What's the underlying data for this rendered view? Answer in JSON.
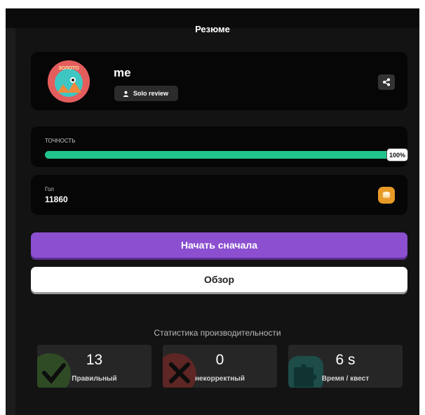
{
  "summary": {
    "title": "Резюме"
  },
  "profile": {
    "username": "me",
    "mode_badge": "Solo review",
    "avatar_text": "ЗОЛОТО",
    "icons": {
      "mode": "person-icon",
      "share": "share-icon"
    }
  },
  "accuracy": {
    "label": "ТОЧНОСТЬ",
    "percent": 100,
    "percent_label": "100%",
    "fill_color": "#22c48e"
  },
  "points": {
    "label": "Гол",
    "value": "11860",
    "icon": "coins-icon",
    "icon_color": "#e79a28"
  },
  "actions": {
    "restart_label": "Начать сначала",
    "restart_color": "#8b4fd0",
    "review_label": "Обзор"
  },
  "stats": {
    "heading": "Статистика производительности",
    "items": [
      {
        "value": "13",
        "label": "Правильный",
        "icon": "check-icon",
        "color": "#2f4b25"
      },
      {
        "value": "0",
        "label": "некорректный",
        "icon": "cross-icon",
        "color": "#5e2624"
      },
      {
        "value": "6 s",
        "label": "Время / квест",
        "icon": "puzzle-icon",
        "color": "#1d4c49"
      }
    ]
  }
}
